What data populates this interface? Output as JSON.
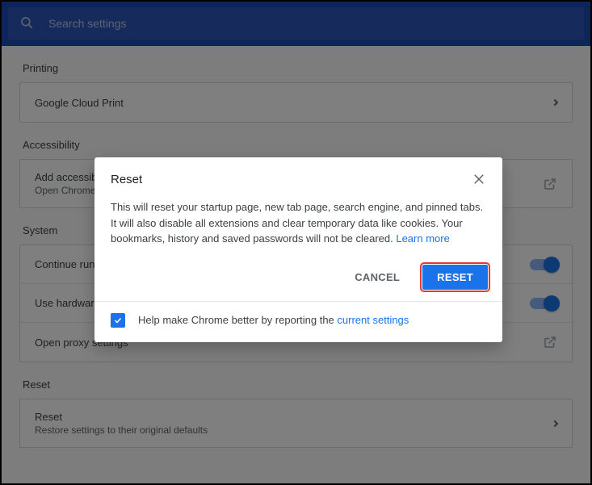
{
  "search": {
    "placeholder": "Search settings"
  },
  "sections": {
    "printing": {
      "title": "Printing",
      "items": [
        {
          "title": "Google Cloud Print",
          "tail": "chevron"
        }
      ]
    },
    "accessibility": {
      "title": "Accessibility",
      "items": [
        {
          "title": "Add accessibility features",
          "sub": "Open Chrome Web Store",
          "tail": "external"
        }
      ]
    },
    "system": {
      "title": "System",
      "items": [
        {
          "title": "Continue running background apps when Google Chrome is closed",
          "tail": "toggle"
        },
        {
          "title": "Use hardware acceleration when available",
          "tail": "toggle"
        },
        {
          "title": "Open proxy settings",
          "tail": "external"
        }
      ]
    },
    "reset": {
      "title": "Reset",
      "items": [
        {
          "title": "Reset",
          "sub": "Restore settings to their original defaults",
          "tail": "chevron"
        }
      ]
    }
  },
  "dialog": {
    "title": "Reset",
    "body_pre": "This will reset your startup page, new tab page, search engine, and pinned tabs. It will also disable all extensions and clear temporary data like cookies. Your bookmarks, history and saved passwords will not be cleared. ",
    "learn_more": "Learn more",
    "cancel": "CANCEL",
    "confirm": "RESET",
    "help_pre": "Help make Chrome better by reporting the ",
    "help_link": "current settings",
    "help_checked": true
  }
}
